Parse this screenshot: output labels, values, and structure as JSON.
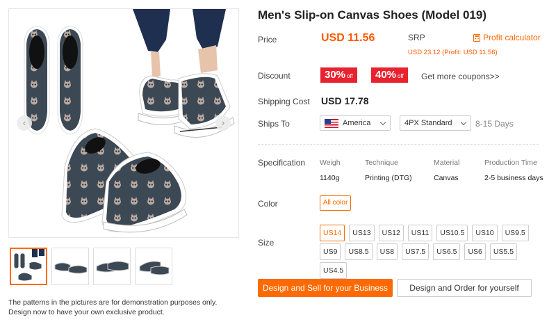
{
  "product": {
    "title": "Men's Slip-on Canvas Shoes (Model 019)"
  },
  "gallery": {
    "prev_icon": "‹",
    "next_icon": "›",
    "thumbnails": [
      "thumb-1",
      "thumb-2",
      "thumb-3",
      "thumb-4"
    ],
    "disclaimer_line1": "The patterns in the pictures are for demonstration purposes only.",
    "disclaimer_line2": "Design now to have your own exclusive product."
  },
  "pricing": {
    "price_label": "Price",
    "price_value": "USD 11.56",
    "srp_label": "SRP",
    "srp_detail": "USD 23.12 (Profit: USD 11.56)",
    "profit_calculator": "Profit calculator"
  },
  "discount": {
    "label": "Discount",
    "coupons": [
      {
        "value": "30%",
        "suffix": "off"
      },
      {
        "value": "40%",
        "suffix": "off"
      }
    ],
    "more_link": "Get more coupons>>"
  },
  "shipping": {
    "cost_label": "Shipping Cost",
    "cost_value": "USD 17.78",
    "ships_to_label": "Ships To",
    "country": "America",
    "method": "4PX Standard",
    "days": "8-15 Days"
  },
  "specification": {
    "label": "Specification",
    "headers": [
      "Weigh",
      "Technique",
      "Material",
      "Production Time"
    ],
    "values": [
      "1140g",
      "Printing (DTG)",
      "Canvas",
      "2-5 business days"
    ]
  },
  "color": {
    "label": "Color",
    "selected": "All color"
  },
  "size": {
    "label": "Size",
    "options": [
      "US14",
      "US13",
      "US12",
      "US11",
      "US10.5",
      "US10",
      "US9.5",
      "US9",
      "US8.5",
      "US8",
      "US7.5",
      "US6.5",
      "US6",
      "US5.5",
      "US4.5"
    ],
    "selected_index": 0
  },
  "actions": {
    "design_sell": "Design and Sell for your Business",
    "design_order": "Design and Order for yourself"
  },
  "colors": {
    "accent": "#ff6a00",
    "price": "#ff5a00",
    "coupon": "#e8232f",
    "shoe_canvas": "#3d4855",
    "shoe_sole": "#ffffff"
  },
  "icons": {
    "profit_calculator": "calculator-icon",
    "country_flag": "us-flag-icon",
    "dropdown": "chevron-down-icon"
  }
}
